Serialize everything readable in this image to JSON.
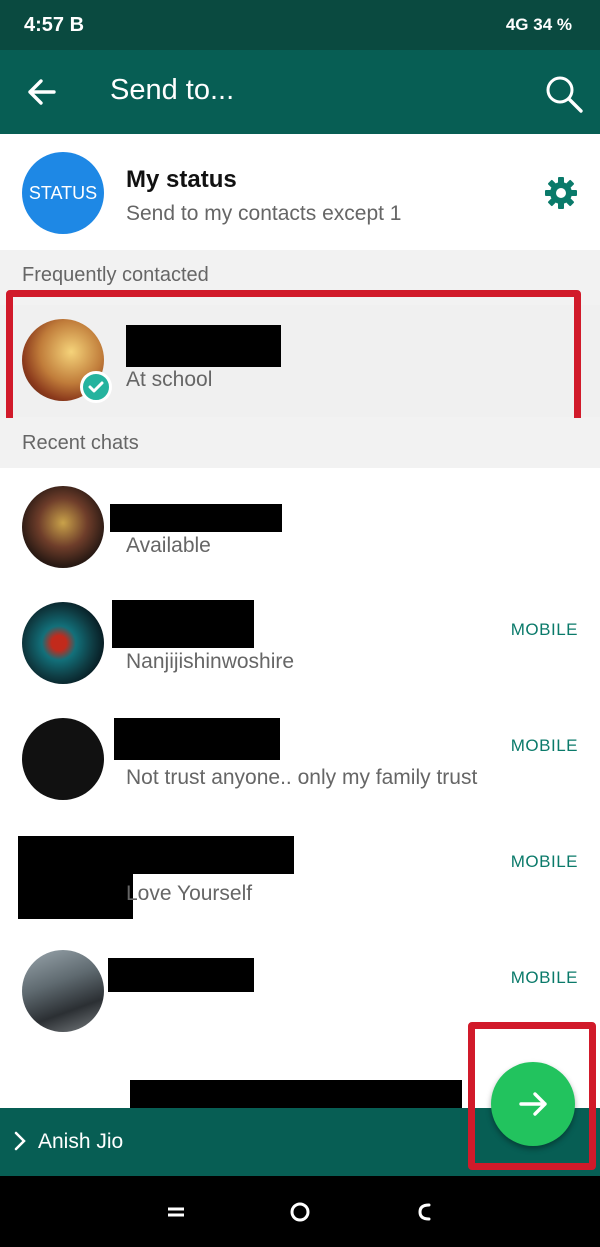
{
  "status_bar": {
    "time": "4:57",
    "carrier_badge": "B",
    "indicators": "4G 34 %"
  },
  "app_bar": {
    "title": "Send to..."
  },
  "my_status": {
    "avatar_text": "STATUS",
    "name": "My status",
    "subtitle": "Send to my contacts except 1"
  },
  "sections": {
    "frequent": "Frequently contacted",
    "recent": "Recent chats"
  },
  "frequent_contact": {
    "status": "At school"
  },
  "recent_chats": [
    {
      "status": "Available",
      "tag": ""
    },
    {
      "status": "Nanjijishinwoshire",
      "tag": "MOBILE"
    },
    {
      "status": "Not trust anyone.. only my family trust",
      "tag": "MOBILE"
    },
    {
      "status": "Love Yourself",
      "tag": "MOBILE"
    },
    {
      "status": "",
      "tag": "MOBILE"
    }
  ],
  "selected_bar": {
    "name": "Anish Jio"
  },
  "colors": {
    "accent": "#075e54",
    "fab": "#22c35e",
    "highlight": "#d11a2a",
    "tag": "#0a7a6a"
  }
}
